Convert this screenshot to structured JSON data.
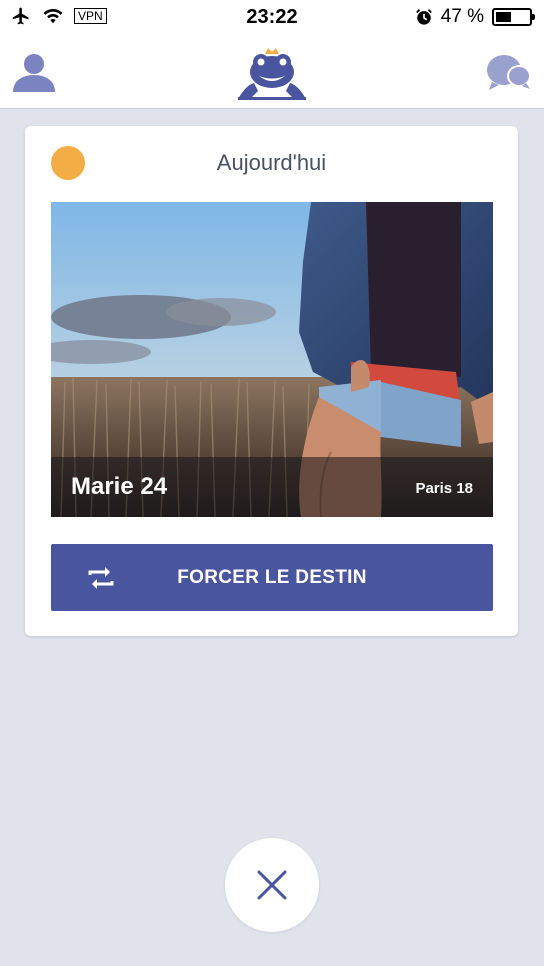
{
  "status_bar": {
    "time": "23:22",
    "vpn_label": "VPN",
    "battery_text": "47 %",
    "battery_level": 0.47,
    "icons": [
      "airplane-icon",
      "wifi-icon",
      "alarm-icon",
      "battery-icon"
    ]
  },
  "nav": {
    "icons": [
      "profile-icon",
      "frog-logo-icon",
      "chat-icon"
    ],
    "accent_color": "#4a55a0",
    "crown_color": "#f2ad45"
  },
  "card": {
    "heading": "Aujourd'hui",
    "status_dot_color": "#f2ad45",
    "profile": {
      "name_age": "Marie 24",
      "location": "Paris 18"
    },
    "action_button": {
      "label": "FORCER LE DESTIN",
      "icon": "repeat-icon",
      "color": "#4a55a0"
    }
  },
  "dismiss_button": {
    "icon": "close-icon"
  }
}
